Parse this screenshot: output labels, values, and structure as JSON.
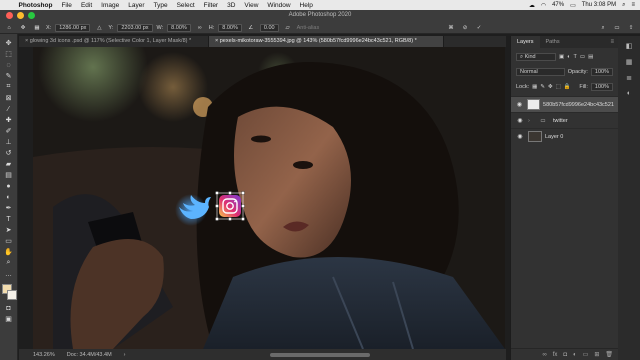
{
  "menubar": {
    "apple_icon": "apple-icon",
    "items": [
      "Photoshop",
      "File",
      "Edit",
      "Image",
      "Layer",
      "Type",
      "Select",
      "Filter",
      "3D",
      "View",
      "Window",
      "Help"
    ],
    "battery": "47%",
    "clock": "Thu 3:08 PM"
  },
  "window": {
    "title": "Adobe Photoshop 2020"
  },
  "options": {
    "x_label": "X:",
    "x_value": "1286.00 px",
    "y_label": "Y:",
    "y_value": "2203.00 px",
    "w_label": "W:",
    "w_value": "8.00%",
    "h_label": "H:",
    "h_value": "8.00%",
    "angle_value": "0.00",
    "interp_label": "Anti-alias"
  },
  "tabs": [
    {
      "label": "glowing 3d icons .psd @ 117% (Selective Color 1, Layer Mask/8) *",
      "active": false
    },
    {
      "label": "pexels-mikotoraw-3555394.jpg @ 143% (580b57fcd9996e24bc43c521, RGB/8) *",
      "active": true
    }
  ],
  "status": {
    "zoom": "143.26%",
    "doc": "Doc: 34.4M/43.4M"
  },
  "panel": {
    "tabs": [
      "Layers",
      "Paths"
    ],
    "kind_label": "Kind",
    "blend_mode": "Normal",
    "opacity_label": "Opacity:",
    "opacity_value": "100%",
    "lock_label": "Lock:",
    "fill_label": "Fill:",
    "fill_value": "100%",
    "layers": [
      {
        "name": "580b57fcd9996e24bc43c521",
        "selected": true,
        "type": "smart"
      },
      {
        "name": "twitter",
        "selected": false,
        "type": "group"
      },
      {
        "name": "Layer 0",
        "selected": false,
        "type": "photo"
      }
    ]
  },
  "colors": {
    "accent": "#1e90ff",
    "foreground": "#f2dcae",
    "background": "#f4f0e8"
  }
}
